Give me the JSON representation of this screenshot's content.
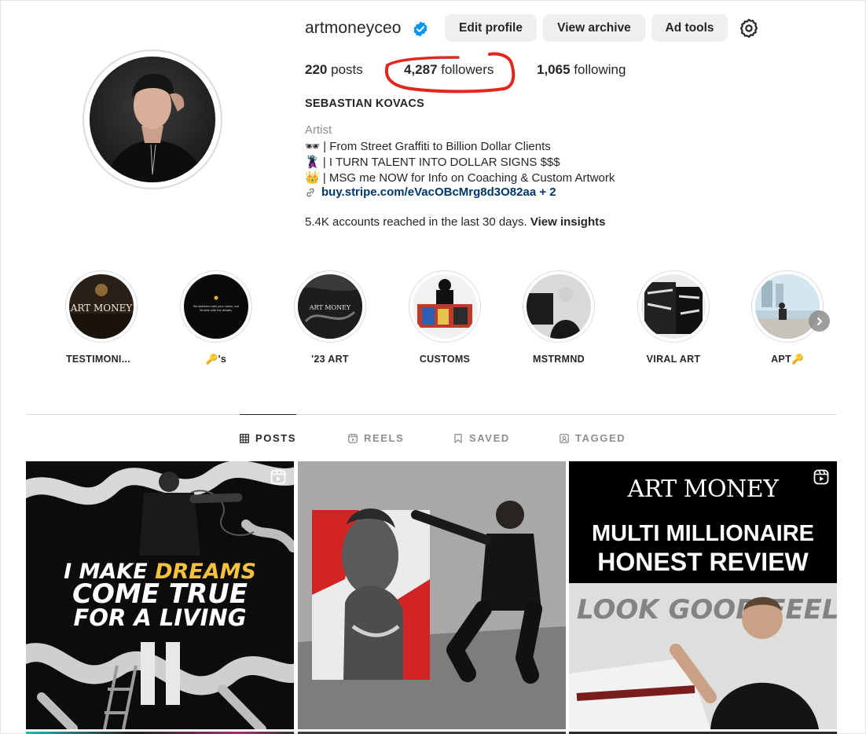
{
  "profile": {
    "username": "artmoneyceo",
    "verified": true,
    "buttons": {
      "edit": "Edit profile",
      "archive": "View archive",
      "ad_tools": "Ad tools"
    },
    "stats": {
      "posts_count": "220",
      "posts_label": "posts",
      "followers_count": "4,287",
      "followers_label": "followers",
      "following_count": "1,065",
      "following_label": "following"
    },
    "full_name": "SEBASTIAN KOVACS",
    "category": "Artist",
    "bio": [
      "🕶 | From Street Graffiti to Billion Dollar Clients",
      "🦹 | I TURN TALENT INTO DOLLAR SIGNS $$$",
      "👑 | MSG me NOW for Info on Coaching & Custom Artwork"
    ],
    "link": "buy.stripe.com/eVacOBcMrg8d3O82aa + 2",
    "insights_text": "5.4K accounts reached in the last 30 days.",
    "insights_link": "View insights"
  },
  "highlights": [
    {
      "label": "TESTIMONI...",
      "thumb_text": "ART MONEY"
    },
    {
      "label": "🔑's",
      "thumb_text": "Be stubborn with your vision, but flexible with the details."
    },
    {
      "label": "'23 ART",
      "thumb_text": "ART MONEY"
    },
    {
      "label": "CUSTOMS"
    },
    {
      "label": "MSTRMND"
    },
    {
      "label": "VIRAL ART"
    },
    {
      "label": "APT🔑"
    }
  ],
  "tabs": [
    {
      "label": "POSTS",
      "icon": "grid-icon",
      "active": true
    },
    {
      "label": "REELS",
      "icon": "reels-icon",
      "active": false
    },
    {
      "label": "SAVED",
      "icon": "bookmark-icon",
      "active": false
    },
    {
      "label": "TAGGED",
      "icon": "tagged-icon",
      "active": false
    }
  ],
  "posts": [
    {
      "type": "reel",
      "line1_a": "I MAKE ",
      "line1_b": "DREAMS",
      "line2": "COME TRUE",
      "line3": "FOR A LIVING"
    },
    {
      "type": "image"
    },
    {
      "type": "reel",
      "brand": "ART MONEY",
      "headline1": "MULTI MILLIONAIRE",
      "headline2": "HONEST REVIEW",
      "bg_text": "LOOK GOOD FEEL GOOD"
    }
  ],
  "colors": {
    "link": "#00376b",
    "verified": "#0095f6",
    "annotation": "#e0281c",
    "highlight_word": "#f6c23e",
    "muted": "#8e8e8e"
  }
}
